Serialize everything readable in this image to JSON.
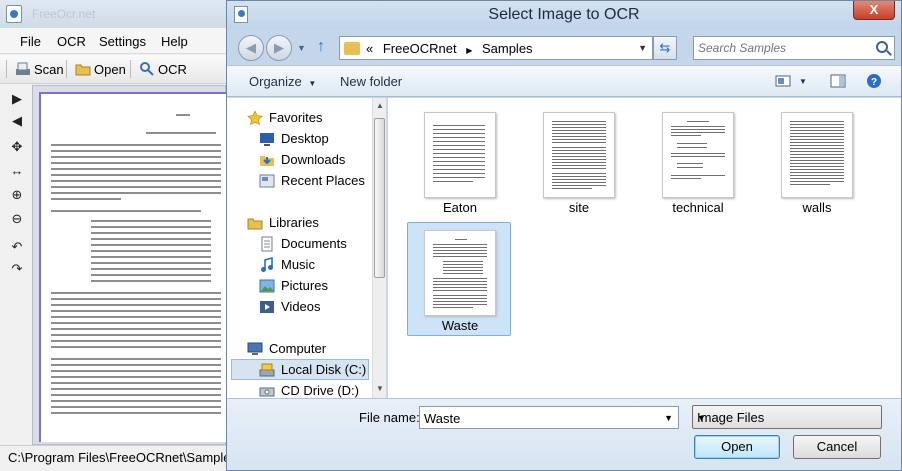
{
  "app": {
    "title_ghost": "FreeOcr.net",
    "menu": [
      "File",
      "OCR",
      "Settings",
      "Help"
    ],
    "toolbar": {
      "scan_label": "Scan",
      "open_label": "Open",
      "ocr_label": "OCR"
    },
    "status_text": "C:\\Program Files\\FreeOCRnet\\Samples\\Waste"
  },
  "dialog": {
    "title": "Select Image to OCR",
    "close_label": "X",
    "breadcrumb": {
      "prefix": "«",
      "parts": [
        "FreeOCRnet",
        "Samples"
      ],
      "separator": "▶"
    },
    "search_placeholder": "Search Samples",
    "commands": {
      "organize_label": "Organize",
      "new_folder_label": "New folder"
    },
    "nav_pane": {
      "items": [
        {
          "label": "Favorites",
          "icon": "star-icon"
        },
        {
          "label": "Desktop",
          "icon": "desktop-icon"
        },
        {
          "label": "Downloads",
          "icon": "downloads-icon"
        },
        {
          "label": "Recent Places",
          "icon": "recent-places-icon"
        },
        {
          "label": "Libraries",
          "icon": "libraries-icon"
        },
        {
          "label": "Documents",
          "icon": "documents-icon"
        },
        {
          "label": "Music",
          "icon": "music-icon"
        },
        {
          "label": "Pictures",
          "icon": "pictures-icon"
        },
        {
          "label": "Videos",
          "icon": "videos-icon"
        },
        {
          "label": "Computer",
          "icon": "computer-icon"
        },
        {
          "label": "Local Disk (C:)",
          "icon": "local-disk-icon"
        },
        {
          "label": "CD Drive (D:)",
          "icon": "cd-drive-icon"
        }
      ]
    },
    "files": [
      {
        "name": "Eaton",
        "selected": false
      },
      {
        "name": "site",
        "selected": false
      },
      {
        "name": "technical",
        "selected": false
      },
      {
        "name": "walls",
        "selected": false
      },
      {
        "name": "Waste",
        "selected": true
      }
    ],
    "footer": {
      "filename_label": "File name:",
      "filename_value": "Waste",
      "filetype_value": "Image Files",
      "open_label": "Open",
      "cancel_label": "Cancel"
    },
    "colors": {
      "frame": "#c3d6ea",
      "selection": "#cde3f7",
      "close": "#c7402b"
    }
  }
}
